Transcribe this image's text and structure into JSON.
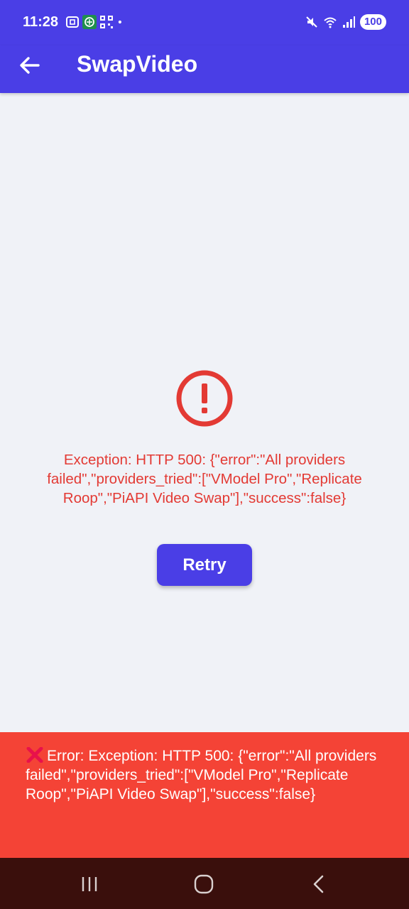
{
  "status_bar": {
    "time": "11:28",
    "battery": "100",
    "icons": [
      "screenshot-icon",
      "app-notification-icon",
      "qr-icon",
      "dot-icon",
      "mute-icon",
      "wifi-icon",
      "signal-icon"
    ]
  },
  "app_bar": {
    "title": "SwapVideo",
    "back_icon": "arrow-back-icon"
  },
  "main": {
    "error_icon": "error-circle-icon",
    "error_message": "Exception: HTTP 500: {\"error\":\"All providers failed\",\"providers_tried\":[\"VModel Pro\",\"Replicate Roop\",\"PiAPI Video Swap\"],\"success\":false}",
    "retry_label": "Retry"
  },
  "snackbar": {
    "message": "Error: Exception: HTTP 500: {\"error\":\"All providers failed\",\"providers_tried\":[\"VModel Pro\",\"Replicate Roop\",\"PiAPI Video Swap\"],\"success\":false}"
  },
  "colors": {
    "primary": "#4a3ee6",
    "error_text": "#e33a34",
    "snackbar_bg": "#f44336",
    "nav_bg": "#3a0f0c",
    "background": "#f0f2f7"
  }
}
